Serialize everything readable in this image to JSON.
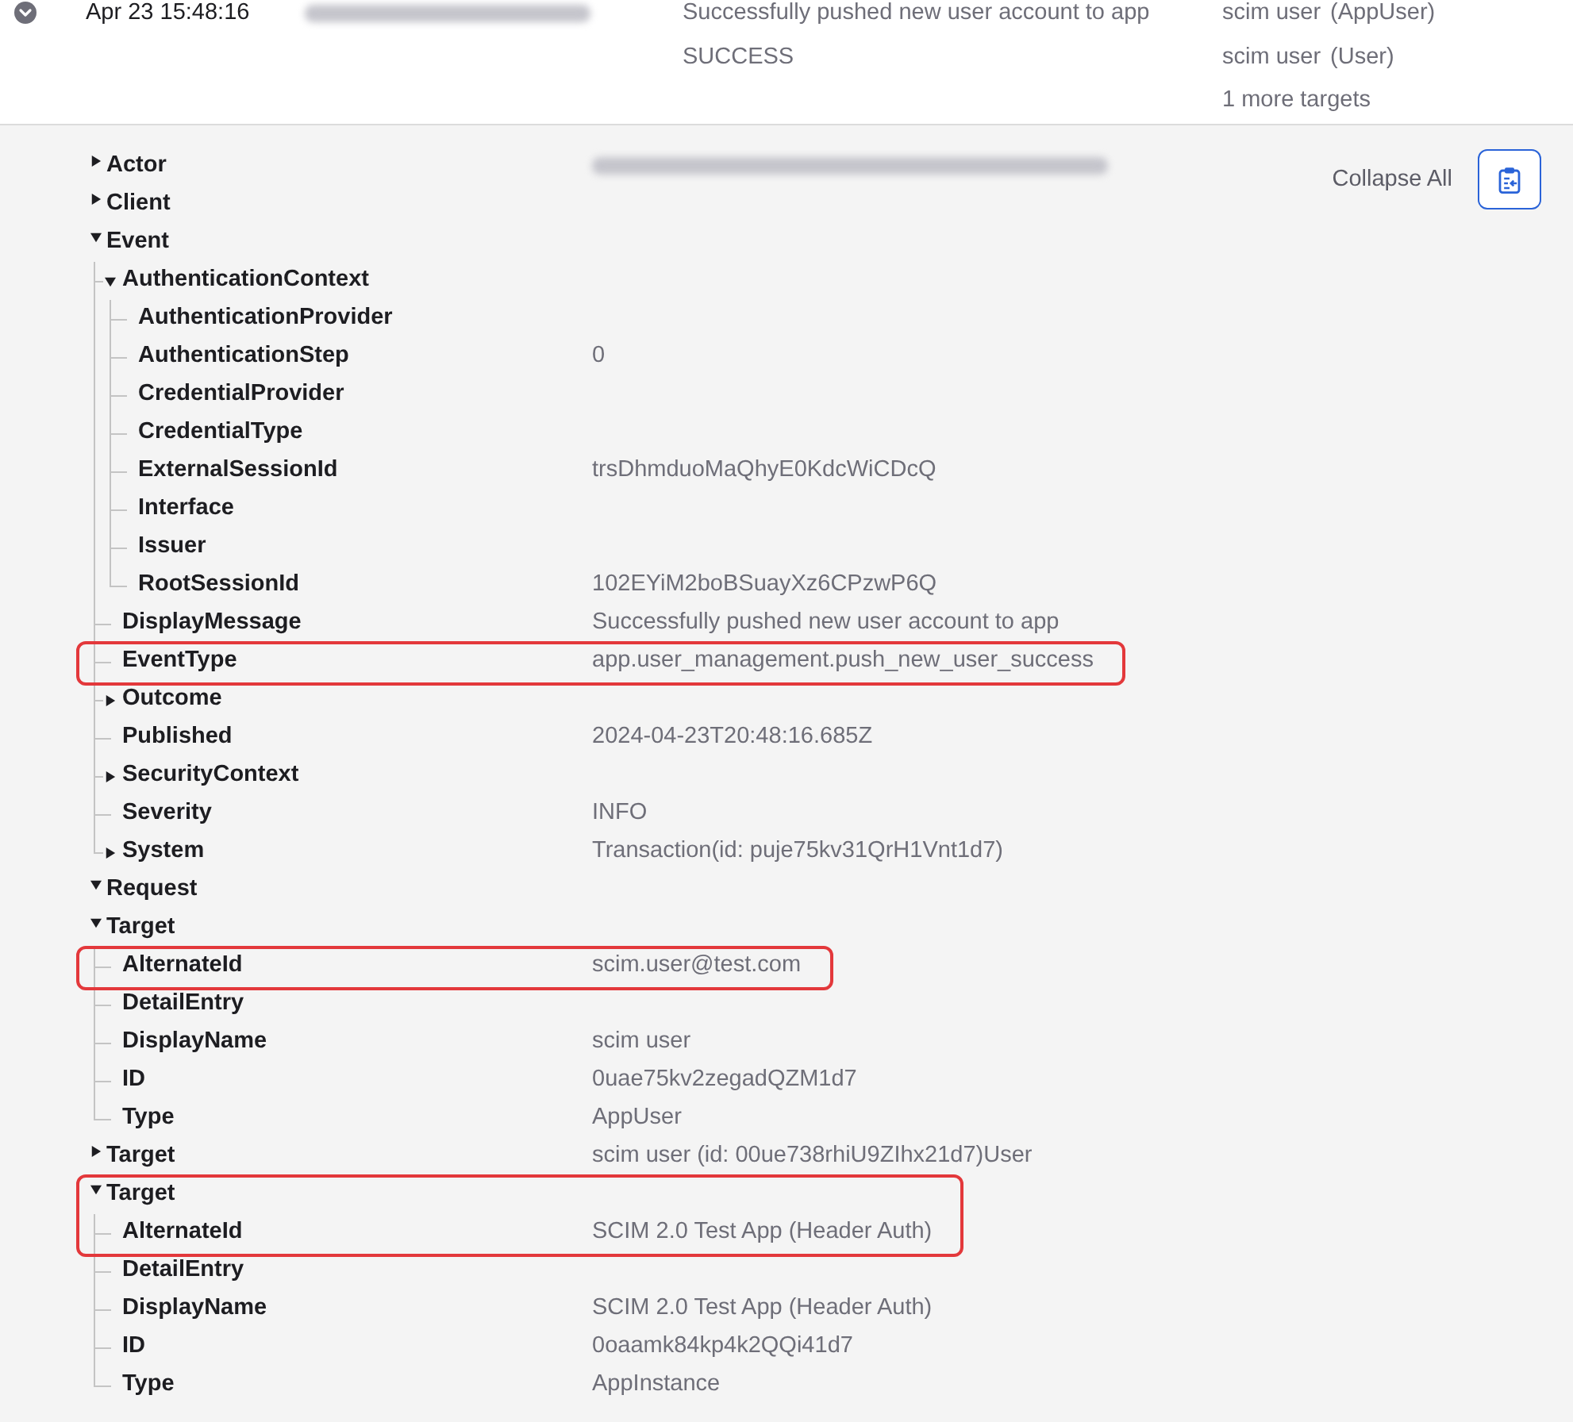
{
  "event_row": {
    "expanded": true,
    "time": "Apr 23 15:48:16",
    "actor_redacted": true,
    "message": "Successfully pushed new user account to app",
    "outcome": "SUCCESS",
    "targets": [
      {
        "name": "scim user",
        "type": "(AppUser)"
      },
      {
        "name": "scim user",
        "type": "(User)"
      }
    ],
    "more_targets": "1 more targets"
  },
  "toolbar": {
    "collapse_all": "Collapse All"
  },
  "tree": [
    {
      "label": "Actor",
      "expanded": false,
      "redacted": true
    },
    {
      "label": "Client",
      "expanded": false
    },
    {
      "label": "Event",
      "expanded": true,
      "children": [
        {
          "label": "AuthenticationContext",
          "expanded": true,
          "children": [
            {
              "label": "AuthenticationProvider"
            },
            {
              "label": "AuthenticationStep",
              "value": "0"
            },
            {
              "label": "CredentialProvider"
            },
            {
              "label": "CredentialType"
            },
            {
              "label": "ExternalSessionId",
              "value": "trsDhmduoMaQhyE0KdcWiCDcQ"
            },
            {
              "label": "Interface"
            },
            {
              "label": "Issuer"
            },
            {
              "label": "RootSessionId",
              "value": "102EYiM2boBSuayXz6CPzwP6Q"
            }
          ]
        },
        {
          "label": "DisplayMessage",
          "value": "Successfully pushed new user account to app"
        },
        {
          "label": "EventType",
          "value": "app.user_management.push_new_user_success",
          "boxed": true
        },
        {
          "label": "Outcome",
          "expanded": false
        },
        {
          "label": "Published",
          "value": "2024-04-23T20:48:16.685Z"
        },
        {
          "label": "SecurityContext",
          "expanded": false
        },
        {
          "label": "Severity",
          "value": "INFO"
        },
        {
          "label": "System",
          "expanded": false,
          "value": "Transaction(id: puje75kv31QrH1Vnt1d7)"
        }
      ]
    },
    {
      "label": "Request",
      "expanded": true
    },
    {
      "label": "Target",
      "expanded": true,
      "children": [
        {
          "label": "AlternateId",
          "value": "scim.user@test.com",
          "boxed": true
        },
        {
          "label": "DetailEntry"
        },
        {
          "label": "DisplayName",
          "value": "scim user"
        },
        {
          "label": "ID",
          "value": "0uae75kv2zegadQZM1d7"
        },
        {
          "label": "Type",
          "value": "AppUser"
        }
      ]
    },
    {
      "label": "Target",
      "expanded": false,
      "value": "scim user (id: 00ue738rhiU9ZIhx21d7)User"
    },
    {
      "label": "Target",
      "expanded": true,
      "boxed": true,
      "children": [
        {
          "label": "AlternateId",
          "value": "SCIM 2.0 Test App (Header Auth)",
          "boxed": true
        },
        {
          "label": "DetailEntry"
        },
        {
          "label": "DisplayName",
          "value": "SCIM 2.0 Test App (Header Auth)"
        },
        {
          "label": "ID",
          "value": "0oaamk84kp4k2QQi41d7"
        },
        {
          "label": "Type",
          "value": "AppInstance"
        }
      ]
    }
  ]
}
